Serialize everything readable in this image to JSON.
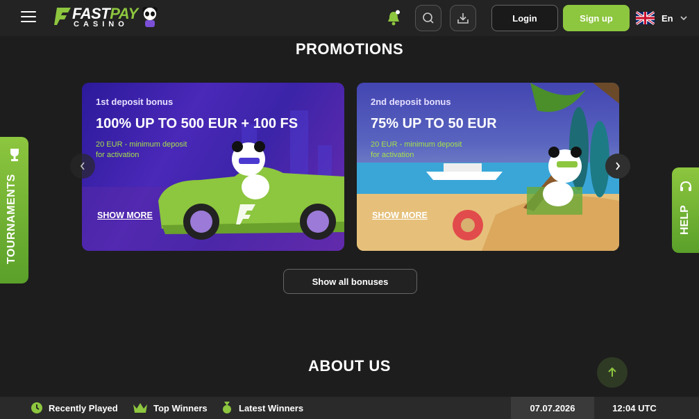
{
  "header": {
    "logo": {
      "fast": "FAST",
      "pay": "PAY",
      "casino": "CASINO"
    },
    "login_label": "Login",
    "signup_label": "Sign up",
    "language": "En",
    "icons": [
      "menu-icon",
      "bell-icon",
      "search-icon",
      "download-icon",
      "uk-flag-icon",
      "chevron-down-icon"
    ]
  },
  "promotions": {
    "title": "PROMOTIONS",
    "cards": [
      {
        "subtitle": "1st deposit bonus",
        "title": "100% UP TO 500 EUR + 100 FS",
        "min_line1": "20 EUR - minimum deposit",
        "min_line2": "for activation",
        "more_label": "SHOW MORE"
      },
      {
        "subtitle": "2nd deposit bonus",
        "title": "75% UP TO 50 EUR",
        "min_line1": "20 EUR - minimum deposit",
        "min_line2": "for activation",
        "more_label": "SHOW MORE"
      }
    ],
    "show_all_label": "Show all bonuses"
  },
  "about": {
    "title": "ABOUT US"
  },
  "side_tabs": {
    "tournaments": "TOURNAMENTS",
    "help": "HELP"
  },
  "footer": {
    "recently_played": "Recently Played",
    "top_winners": "Top Winners",
    "latest_winners": "Latest Winners",
    "date": "07.07.2026",
    "time": "12:04 UTC"
  },
  "colors": {
    "accent": "#8dc63f",
    "background": "#1d1d1d",
    "header": "#232323"
  }
}
